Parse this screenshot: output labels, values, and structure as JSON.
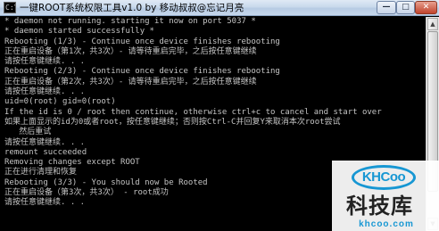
{
  "window": {
    "title": "一键ROOT系统权限工具v1.0 by 移动叔叔@忘记月亮",
    "icon": "console-icon",
    "controls": {
      "minimize": "—",
      "maximize": "□",
      "close": "✕"
    }
  },
  "console": {
    "lines": [
      "* daemon not running. starting it now on port 5037 *",
      "* daemon started successfully *",
      "Rebooting (1/3) - Continue once device finishes rebooting",
      "正在重启设备（第1次，共3次）- 请等待重启完毕，之后按任意键继续",
      "请按任意键继续. . .",
      "Rebooting (2/3) - Continue once device finishes rebooting",
      "正在重启设备（第2次，共3次）- 请等待重启完毕，之后按任意键继续",
      "请按任意键继续. . .",
      "uid=0(root) gid=0(root)",
      "If the id is 0 / root then continue, otherwise ctrl+c to cancel and start over",
      "如果上面显示的id为0或者root，按任意键继续；否则按Ctrl-C并回复Y来取消本次root尝试",
      "   然后重试",
      "请按任意键继续. . .",
      "remount succeeded",
      "Removing changes except ROOT",
      "正在进行清理和恢复",
      "Rebooting (3/3) - You should now be Rooted",
      "正在重启设备（第3次，共3次） - root成功",
      "请按任意键继续. . ."
    ]
  },
  "watermark": {
    "badge": "KHCoo",
    "name": "科技库",
    "domain": "khcoo.com"
  },
  "scrollbar": {
    "up": "▲",
    "down": "▼"
  }
}
